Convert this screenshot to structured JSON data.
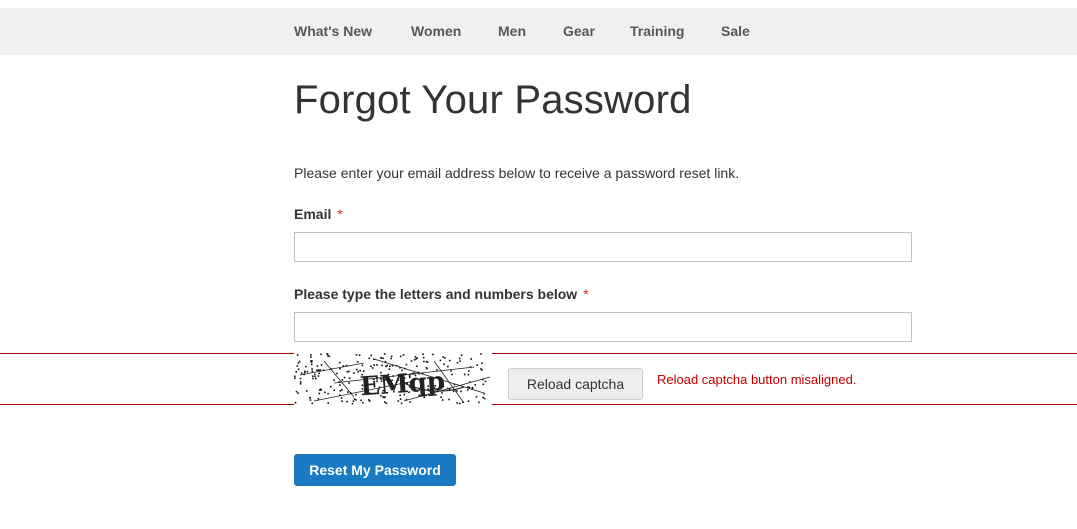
{
  "nav": {
    "items": [
      {
        "label": "What's New"
      },
      {
        "label": "Women"
      },
      {
        "label": "Men"
      },
      {
        "label": "Gear"
      },
      {
        "label": "Training"
      },
      {
        "label": "Sale"
      }
    ]
  },
  "page": {
    "title": "Forgot Your Password",
    "intro": "Please enter your email address below to receive a password reset link."
  },
  "form": {
    "email_label": "Email",
    "email_value": "",
    "captcha_label": "Please type the letters and numbers below",
    "captcha_value": "",
    "required_marker": "*",
    "captcha_text": "EMqp",
    "reload_label": "Reload captcha",
    "submit_label": "Reset My Password"
  },
  "annotation": {
    "text": "Reload captcha button misaligned.",
    "color": "#c00000"
  },
  "colors": {
    "primary": "#1979c3",
    "required": "#e02b27",
    "nav_bg": "#f0f0f0",
    "highlight_line": "#a40000"
  }
}
